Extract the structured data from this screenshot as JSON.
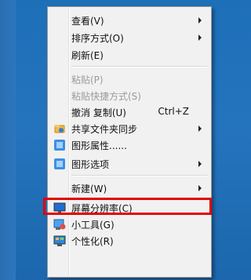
{
  "context_menu": {
    "items": [
      {
        "label": "查看(V)",
        "submenu": true
      },
      {
        "label": "排序方式(O)",
        "submenu": true
      },
      {
        "label": "刷新(E)"
      },
      {
        "label": "粘贴(P)",
        "disabled": true
      },
      {
        "label": "粘贴快捷方式(S)",
        "disabled": true
      },
      {
        "label": "撤消 复制(U)",
        "shortcut": "Ctrl+Z"
      },
      {
        "label": "共享文件夹同步",
        "submenu": true,
        "icon": "sync-folder-icon"
      },
      {
        "label": "图形属性......",
        "icon": "graphics-properties-icon"
      },
      {
        "label": "图形选项",
        "submenu": true,
        "icon": "graphics-options-icon"
      },
      {
        "label": "新建(W)",
        "submenu": true
      },
      {
        "label": "屏幕分辨率(C)",
        "icon": "screen-resolution-icon",
        "highlighted": true
      },
      {
        "label": "小工具(G)",
        "icon": "gadgets-icon"
      },
      {
        "label": "个性化(R)",
        "icon": "personalize-icon"
      }
    ]
  },
  "colors": {
    "highlight_box": "#e10000",
    "desktop": "#1d6fb8"
  }
}
